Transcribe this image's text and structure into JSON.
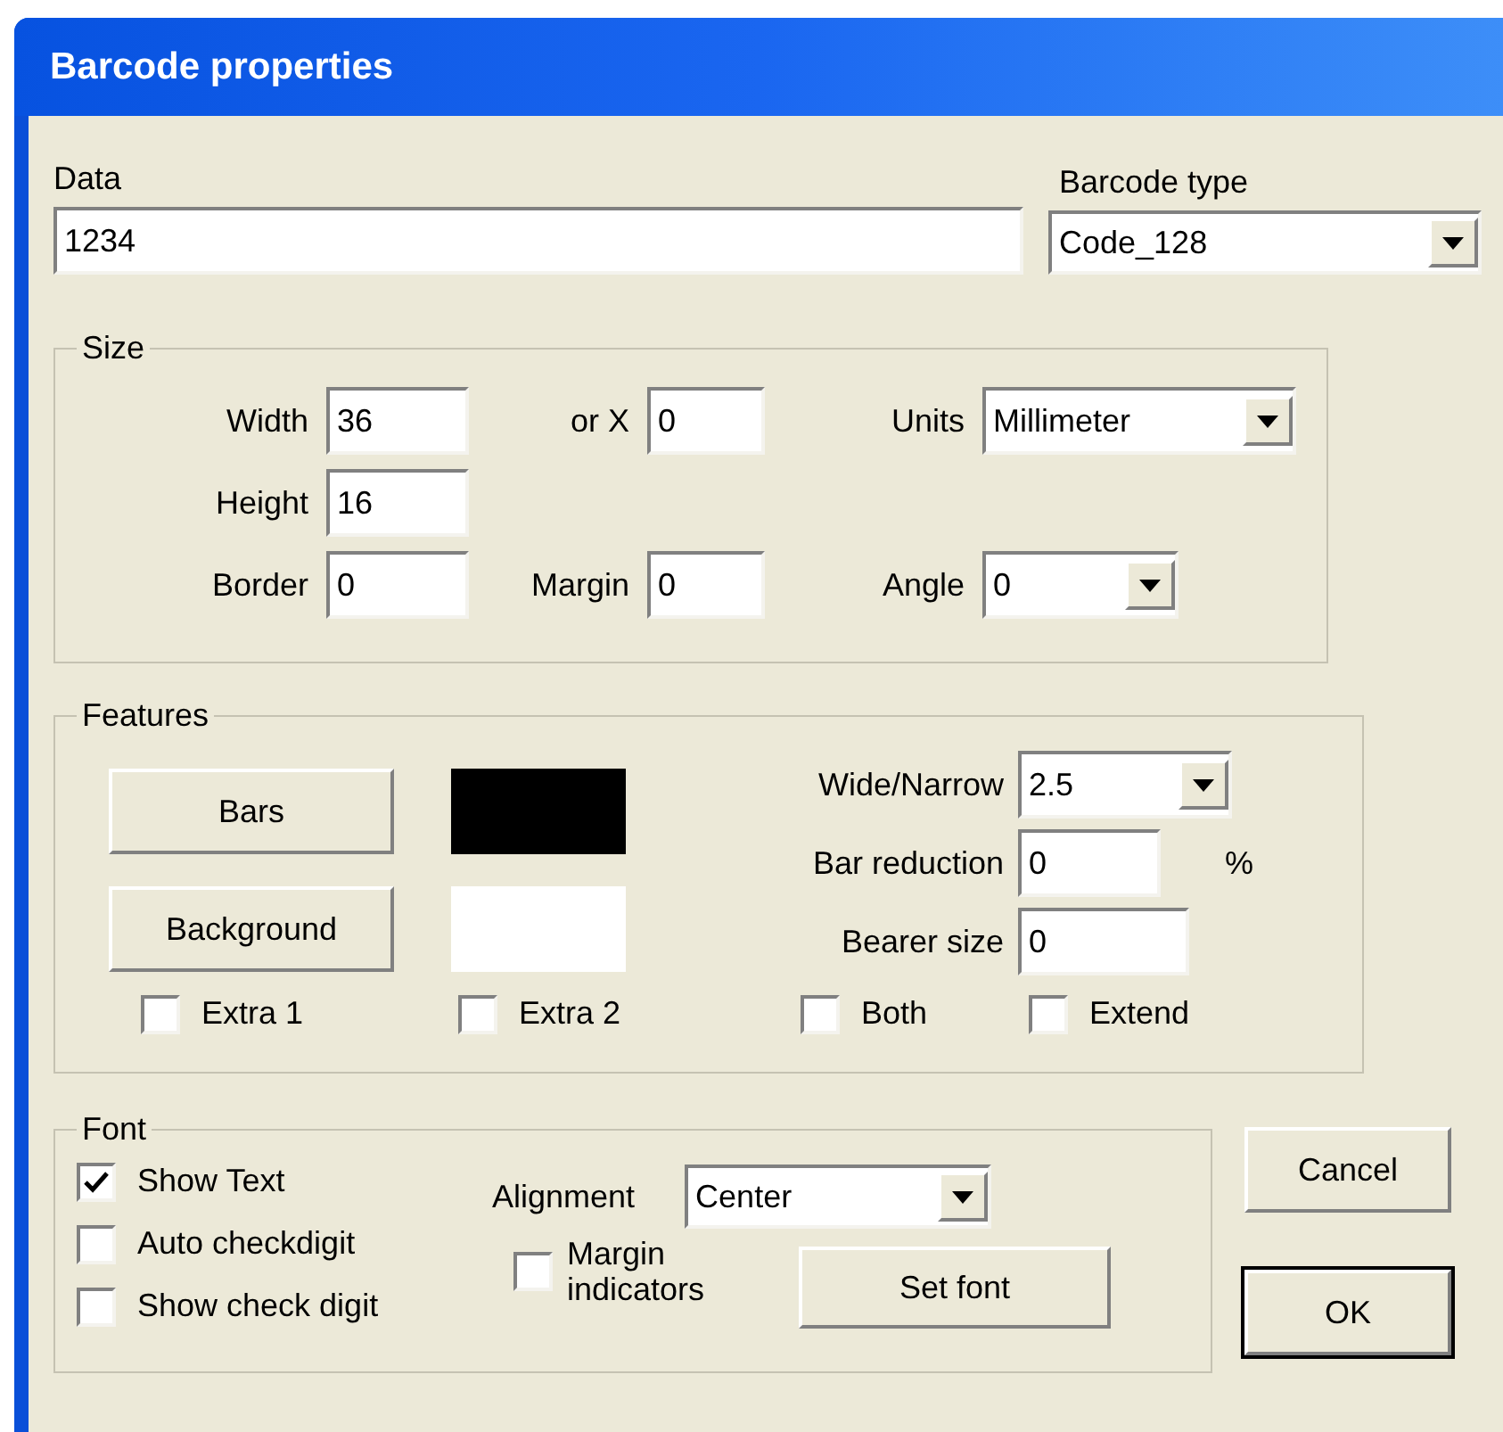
{
  "window": {
    "title": "Barcode properties"
  },
  "data_field": {
    "label": "Data",
    "value": "1234"
  },
  "barcode_type": {
    "label": "Barcode type",
    "value": "Code_128"
  },
  "size": {
    "title": "Size",
    "rows": [
      {
        "cells": [
          {
            "label": "Width",
            "kind": "input",
            "value": "36"
          },
          {
            "label": "or X",
            "kind": "input",
            "value": "0"
          },
          {
            "label": "Units",
            "kind": "dropdown",
            "value": "Millimeter"
          }
        ]
      },
      {
        "cells": [
          {
            "label": "Height",
            "kind": "input",
            "value": "16"
          }
        ]
      },
      {
        "cells": [
          {
            "label": "Border",
            "kind": "input",
            "value": "0"
          },
          {
            "label": "Margin",
            "kind": "input",
            "value": "0"
          },
          {
            "label": "Angle",
            "kind": "dropdown",
            "value": "0"
          }
        ]
      }
    ]
  },
  "features": {
    "title": "Features",
    "color_buttons": [
      {
        "label": "Bars",
        "color": "#000000"
      },
      {
        "label": "Background",
        "color": "#ffffff"
      }
    ],
    "fields": [
      {
        "label": "Wide/Narrow",
        "kind": "dropdown",
        "value": "2.5"
      },
      {
        "label": "Bar reduction",
        "kind": "input",
        "value": "0",
        "unit": "%"
      },
      {
        "label": "Bearer size",
        "kind": "input",
        "value": "0"
      }
    ],
    "checkboxes": [
      {
        "label": "Extra 1",
        "checked": false
      },
      {
        "label": "Extra 2",
        "checked": false
      },
      {
        "label": "Both",
        "checked": false
      },
      {
        "label": "Extend",
        "checked": false
      }
    ]
  },
  "font": {
    "title": "Font",
    "checkboxes": [
      {
        "label": "Show Text",
        "checked": true
      },
      {
        "label": "Auto checkdigit",
        "checked": false
      },
      {
        "label": "Show check digit",
        "checked": false
      }
    ],
    "alignment": {
      "label": "Alignment",
      "value": "Center"
    },
    "margin_indicators": {
      "label": "Margin indicators",
      "checked": false
    },
    "set_font_button": "Set font"
  },
  "buttons": [
    {
      "label": "Cancel",
      "default": false
    },
    {
      "label": "OK",
      "default": true
    }
  ]
}
